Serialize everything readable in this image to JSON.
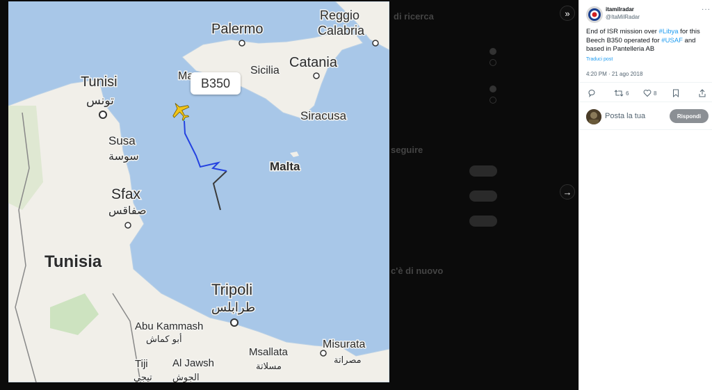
{
  "background_page": {
    "search_heading": "di ricerca",
    "follow_heading": "seguire",
    "whats_new_heading": "c'è di nuovo",
    "follow_button": "Segui"
  },
  "media": {
    "callout_label": "B350",
    "cities": {
      "palermo": "Palermo",
      "reggio": "Reggio",
      "calabria": "Calabria",
      "sicilia": "Sicilia",
      "catania": "Catania",
      "siracusa": "Siracusa",
      "malta": "Malta",
      "tunisi": "Tunisi",
      "tunisi_ar": "تونس",
      "susa": "Susa",
      "susa_ar": "سوسة",
      "sfax": "Sfax",
      "sfax_ar": "صفاقس",
      "tunisia": "Tunisia",
      "tripoli": "Tripoli",
      "tripoli_ar": "طرابلس",
      "abu_kammash": "Abu Kammash",
      "abu_kammash_ar": "أبو كماش",
      "msallata": "Msallata",
      "msallata_ar": "مسلاتة",
      "misurata": "Misurata",
      "misurata_ar": "مصراتة",
      "tiji": "Tiji",
      "tiji_ar": "تيجي",
      "al_jawsh": "Al Jawsh",
      "al_jawsh_ar": "الجوش",
      "marsala_partial": "Ma"
    },
    "colors": {
      "sea": "#a8c7e8",
      "land": "#f1efe9",
      "plane": "#f2c417",
      "track_low": "#3a3a3a",
      "track_high": "#2442e0"
    }
  },
  "lightbox": {
    "collapse_icon": "»",
    "next_icon": "→"
  },
  "tweet": {
    "author_name": "itamilradar",
    "author_handle": "@ItaMilRadar",
    "text_parts": {
      "p1": "End of ISR mission over ",
      "tag1": "#Libya",
      "p2": " for this Beech B350 operated for ",
      "tag2": "#USAF",
      "p3": " and based in Pantelleria AB"
    },
    "translate": "Traduci post",
    "timestamp": "4:20 PM · 21 ago 2018",
    "retweets": "6",
    "likes": "8",
    "reply_placeholder": "Posta la tua",
    "reply_button": "Rispondi"
  }
}
